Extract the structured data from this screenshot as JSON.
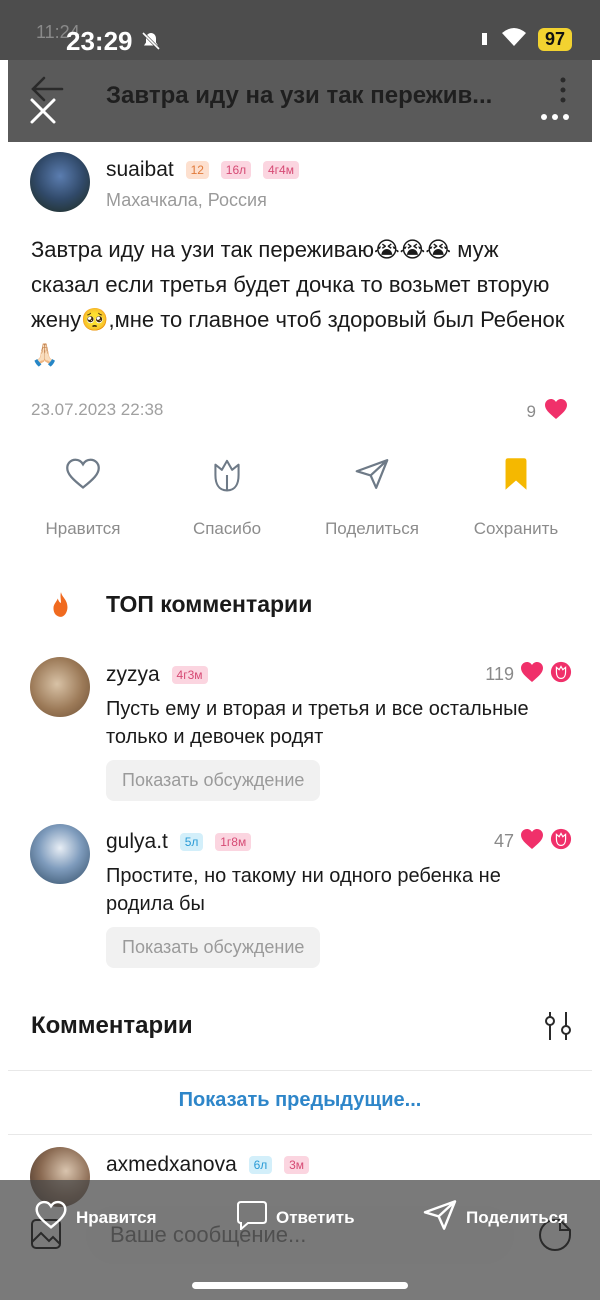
{
  "status": {
    "ghost_time": "11:24",
    "time": "23:29",
    "battery": "97"
  },
  "header": {
    "title": "Завтра иду на узи так пережив..."
  },
  "post": {
    "author": "suaibat",
    "badges": [
      "12",
      "16л",
      "4г4м"
    ],
    "location": "Махачкала, Россия",
    "text": "Завтра иду на узи так переживаю😭😭😭 муж сказал если третья будет дочка то возьмет вторую жену🥺,мне то  главное чтоб здоровый был Ребенок🙏🏻",
    "date": "23.07.2023 22:38",
    "likes": "9"
  },
  "actions": {
    "like": "Нравится",
    "thanks": "Спасибо",
    "share": "Поделиться",
    "save": "Сохранить"
  },
  "top_comments": {
    "title": "ТОП комментарии",
    "items": [
      {
        "user": "zyzya",
        "badge": "4г3м",
        "count": "119",
        "text": "Пусть ему и вторая и третья и все остальные только и девочек родят",
        "show": "Показать обсуждение"
      },
      {
        "user": "gulya.t",
        "badge1": "5л",
        "badge2": "1г8м",
        "count": "47",
        "text": "Простите, но такому ни одного ребенка не родила бы",
        "show": "Показать обсуждение"
      }
    ]
  },
  "comments": {
    "title": "Комментарии",
    "show_previous": "Показать предыдущие...",
    "first": {
      "user": "axmedxanova",
      "badge1": "6л",
      "badge2": "3м"
    }
  },
  "bottom_bar": {
    "like": "Нравится",
    "reply": "Ответить",
    "share": "Поделиться",
    "placeholder": "Ваше сообщение..."
  },
  "colors": {
    "accent_blue": "#2e86c9",
    "heart": "#f0306a",
    "bookmark": "#f5b800",
    "fire": "#f06a1f"
  }
}
